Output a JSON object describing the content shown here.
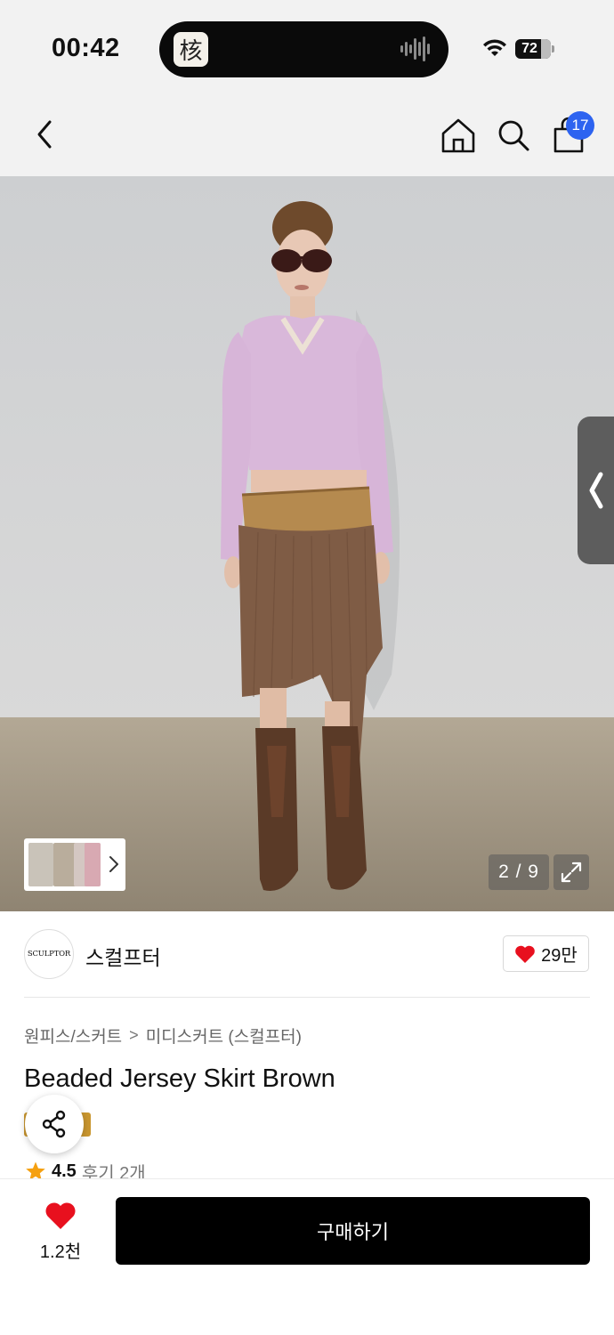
{
  "status_bar": {
    "time": "00:42",
    "battery_level": "72",
    "battery_fraction": 0.72,
    "island_app_glyph": "核"
  },
  "nav": {
    "back_icon": "chevron-left-icon",
    "home_icon": "home-icon",
    "search_icon": "search-icon",
    "cart_icon": "shopping-bag-icon",
    "cart_count": "17"
  },
  "gallery": {
    "page_indicator": "2 / 9",
    "expand_icon": "expand-icon",
    "side_tab_icon": "chevron-left-icon"
  },
  "brand": {
    "logo_text": "SCULPTOR",
    "name": "스컬프터",
    "like_count": "29만"
  },
  "breadcrumb": {
    "category": "원피스/스커트",
    "separator": ">",
    "subcategory": "미디스커트 (스컬프터)"
  },
  "product": {
    "title": "Beaded Jersey Skirt Brown",
    "rating": "4.5",
    "reviews": "후기 2개"
  },
  "bottom_bar": {
    "wish_count": "1.2천",
    "buy_label": "구매하기"
  },
  "colors": {
    "badge_blue": "#2d63f0",
    "heart_red": "#e8101e",
    "star_orange": "#f5a010",
    "buy_black": "#000000",
    "tag_gold": "#c9962f"
  }
}
